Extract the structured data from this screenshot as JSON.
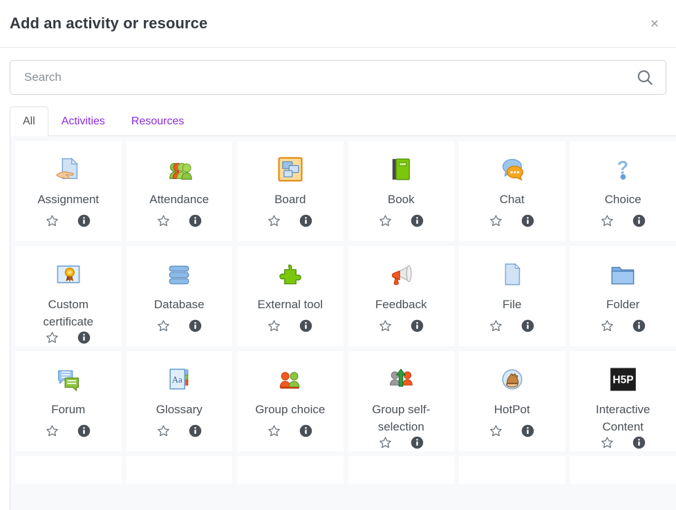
{
  "header": {
    "title": "Add an activity or resource",
    "close_label": "×",
    "close_icon": "close-icon"
  },
  "search": {
    "placeholder": "Search",
    "value": "",
    "icon": "search-icon"
  },
  "tabs": [
    {
      "label": "All",
      "active": true
    },
    {
      "label": "Activities",
      "active": false
    },
    {
      "label": "Resources",
      "active": false
    }
  ],
  "colors": {
    "tab_link": "#8a2be2",
    "grid_background": "#f8f9fa",
    "tile_background": "#ffffff",
    "border": "#dee2e6",
    "text": "#495057",
    "title": "#343a40",
    "icon_gray": "#5a6570"
  },
  "tile_actions": {
    "favourite_icon": "star-outline-icon",
    "info_icon": "info-circle-icon"
  },
  "items": [
    {
      "label": "Assignment",
      "icon": "assignment-icon"
    },
    {
      "label": "Attendance",
      "icon": "attendance-icon"
    },
    {
      "label": "Board",
      "icon": "board-icon"
    },
    {
      "label": "Book",
      "icon": "book-icon"
    },
    {
      "label": "Chat",
      "icon": "chat-icon"
    },
    {
      "label": "Choice",
      "icon": "choice-icon"
    },
    {
      "label": "Custom certificate",
      "icon": "custom-certificate-icon"
    },
    {
      "label": "Database",
      "icon": "database-icon"
    },
    {
      "label": "External tool",
      "icon": "external-tool-icon"
    },
    {
      "label": "Feedback",
      "icon": "feedback-icon"
    },
    {
      "label": "File",
      "icon": "file-icon"
    },
    {
      "label": "Folder",
      "icon": "folder-icon"
    },
    {
      "label": "Forum",
      "icon": "forum-icon"
    },
    {
      "label": "Glossary",
      "icon": "glossary-icon"
    },
    {
      "label": "Group choice",
      "icon": "group-choice-icon"
    },
    {
      "label": "Group self-selection",
      "icon": "group-self-selection-icon"
    },
    {
      "label": "HotPot",
      "icon": "hotpot-icon"
    },
    {
      "label": "Interactive Content",
      "icon": "h5p-icon"
    }
  ],
  "partial_row_count": 6
}
